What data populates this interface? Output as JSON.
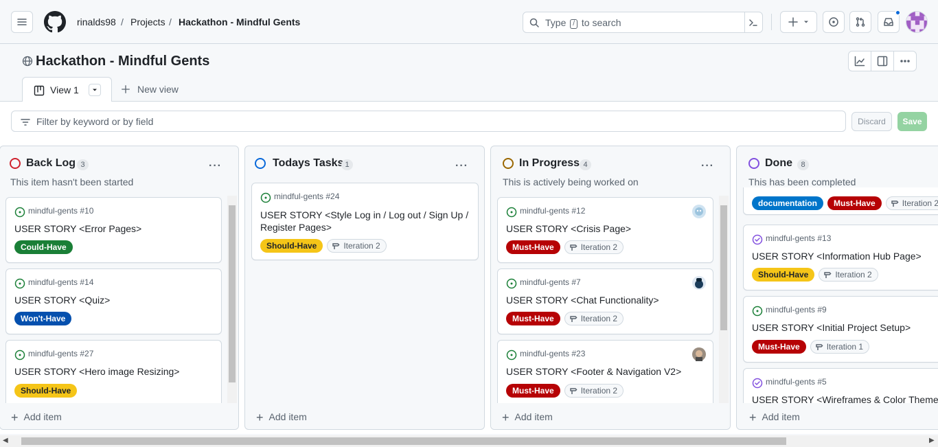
{
  "topbar": {
    "owner": "rinalds98",
    "section": "Projects",
    "project": "Hackathon - Mindful Gents",
    "search_placeholder_pre": "Type",
    "search_placeholder_key": "/",
    "search_placeholder_post": "to search"
  },
  "project": {
    "title": "Hackathon - Mindful Gents",
    "tabs": [
      {
        "label": "View 1"
      }
    ],
    "new_view": "New view"
  },
  "filter": {
    "placeholder": "Filter by keyword or by field",
    "discard": "Discard",
    "save": "Save"
  },
  "columns": [
    {
      "title": "Back Log",
      "count": "3",
      "description": "This item hasn't been started",
      "status_color": "#cf222e",
      "add": "Add item",
      "cards": [
        {
          "ref": "mindful-gents #10",
          "title": "USER STORY <Error Pages>",
          "labels": [
            {
              "text": "Could-Have",
              "bg": "#1a7f37",
              "fg": "#ffffff"
            }
          ]
        },
        {
          "ref": "mindful-gents #14",
          "title": "USER STORY <Quiz>",
          "labels": [
            {
              "text": "Won't-Have",
              "bg": "#0550ae",
              "fg": "#ffffff"
            }
          ]
        },
        {
          "ref": "mindful-gents #27",
          "title": "USER STORY <Hero image Resizing>",
          "labels": [
            {
              "text": "Should-Have",
              "bg": "#f5c518",
              "fg": "#1f2328"
            }
          ]
        }
      ]
    },
    {
      "title": "Todays Tasks",
      "count": "1",
      "description": "",
      "status_color": "#0969da",
      "add": "Add item",
      "cards": [
        {
          "ref": "mindful-gents #24",
          "title_line1": "USER STORY <Style Log in / Log out / Sign Up /",
          "title_line2": "Register Pages>",
          "labels": [
            {
              "text": "Should-Have",
              "bg": "#f5c518",
              "fg": "#1f2328"
            }
          ],
          "iteration": "Iteration 2"
        }
      ]
    },
    {
      "title": "In Progress",
      "count": "4",
      "description": "This is actively being worked on",
      "status_color": "#9a6700",
      "add": "Add item",
      "cards": [
        {
          "ref": "mindful-gents #12",
          "title": "USER STORY <Crisis Page>",
          "labels": [
            {
              "text": "Must-Have",
              "bg": "#b60205",
              "fg": "#ffffff"
            }
          ],
          "iteration": "Iteration 2"
        },
        {
          "ref": "mindful-gents #7",
          "title": "USER STORY <Chat Functionality>",
          "labels": [
            {
              "text": "Must-Have",
              "bg": "#b60205",
              "fg": "#ffffff"
            }
          ],
          "iteration": "Iteration 2"
        },
        {
          "ref": "mindful-gents #23",
          "title": "USER STORY <Footer & Navigation V2>",
          "labels": [
            {
              "text": "Must-Have",
              "bg": "#b60205",
              "fg": "#ffffff"
            }
          ],
          "iteration": "Iteration 2"
        }
      ]
    },
    {
      "title": "Done",
      "count": "8",
      "description": "This has been completed",
      "status_color": "#8250df",
      "add": "Add item",
      "partial_labels": [
        {
          "text": "documentation",
          "bg": "#0075ca",
          "fg": "#ffffff"
        },
        {
          "text": "Must-Have",
          "bg": "#b60205",
          "fg": "#ffffff"
        }
      ],
      "partial_iteration": "Iteration 2",
      "cards": [
        {
          "ref": "mindful-gents #13",
          "title": "USER STORY <Information Hub Page>",
          "labels": [
            {
              "text": "Should-Have",
              "bg": "#f5c518",
              "fg": "#1f2328"
            }
          ],
          "iteration": "Iteration 2"
        },
        {
          "ref": "mindful-gents #9",
          "title": "USER STORY <Initial Project Setup>",
          "labels": [
            {
              "text": "Must-Have",
              "bg": "#b60205",
              "fg": "#ffffff"
            }
          ],
          "iteration": "Iteration 1"
        },
        {
          "ref": "mindful-gents #5",
          "title": "USER STORY <Wireframes & Color Theme>"
        }
      ]
    }
  ]
}
